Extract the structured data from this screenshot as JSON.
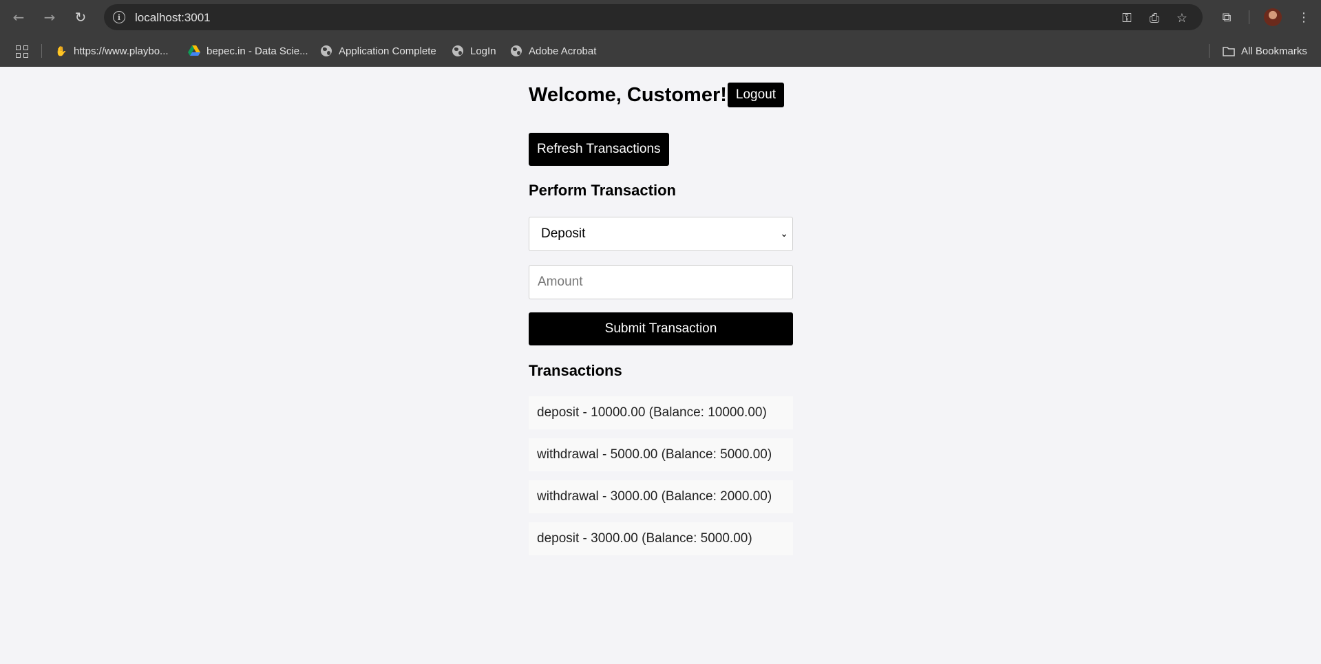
{
  "browser": {
    "url": "localhost:3001",
    "bookmarks": [
      {
        "label": "https://www.playbo...",
        "icon": "playbook-icon"
      },
      {
        "label": "bepec.in - Data Scie...",
        "icon": "drive-icon"
      },
      {
        "label": "Application Complete",
        "icon": "globe-icon"
      },
      {
        "label": "LogIn",
        "icon": "globe-icon"
      },
      {
        "label": "Adobe Acrobat",
        "icon": "globe-icon"
      }
    ],
    "all_bookmarks_label": "All Bookmarks"
  },
  "header": {
    "welcome": "Welcome, Customer!",
    "logout_label": "Logout"
  },
  "refresh_label": "Refresh Transactions",
  "form": {
    "title": "Perform Transaction",
    "type_selected": "Deposit",
    "amount_placeholder": "Amount",
    "amount_value": "",
    "submit_label": "Submit Transaction"
  },
  "transactions": {
    "title": "Transactions",
    "items": [
      "deposit - 10000.00 (Balance: 10000.00)",
      "withdrawal - 5000.00 (Balance: 5000.00)",
      "withdrawal - 3000.00 (Balance: 2000.00)",
      "deposit - 3000.00 (Balance: 5000.00)"
    ]
  },
  "colors": {
    "chrome": "#3c3c3c",
    "omnibox": "#282828",
    "page_bg": "#f4f4f7",
    "button": "#000000",
    "tx_bg": "#f9f9f9"
  }
}
